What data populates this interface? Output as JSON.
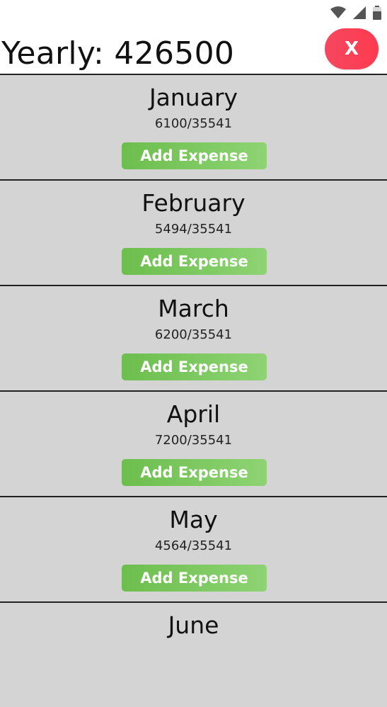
{
  "status_bar": {
    "icons": [
      "wifi-icon",
      "signal-icon",
      "battery-icon"
    ]
  },
  "header": {
    "yearly_text": "Yearly: 426500",
    "close_label": "X"
  },
  "months": [
    {
      "name": "January",
      "amount": "6100/35541",
      "button": "Add Expense"
    },
    {
      "name": "February",
      "amount": "5494/35541",
      "button": "Add Expense"
    },
    {
      "name": "March",
      "amount": "6200/35541",
      "button": "Add Expense"
    },
    {
      "name": "April",
      "amount": "7200/35541",
      "button": "Add Expense"
    },
    {
      "name": "May",
      "amount": "4564/35541",
      "button": "Add Expense"
    },
    {
      "name": "June",
      "amount": "",
      "button": ""
    }
  ],
  "colors": {
    "accent_green": "#6cbe4d",
    "close_red": "#f5475e",
    "card_bg": "#d4d4d4"
  }
}
